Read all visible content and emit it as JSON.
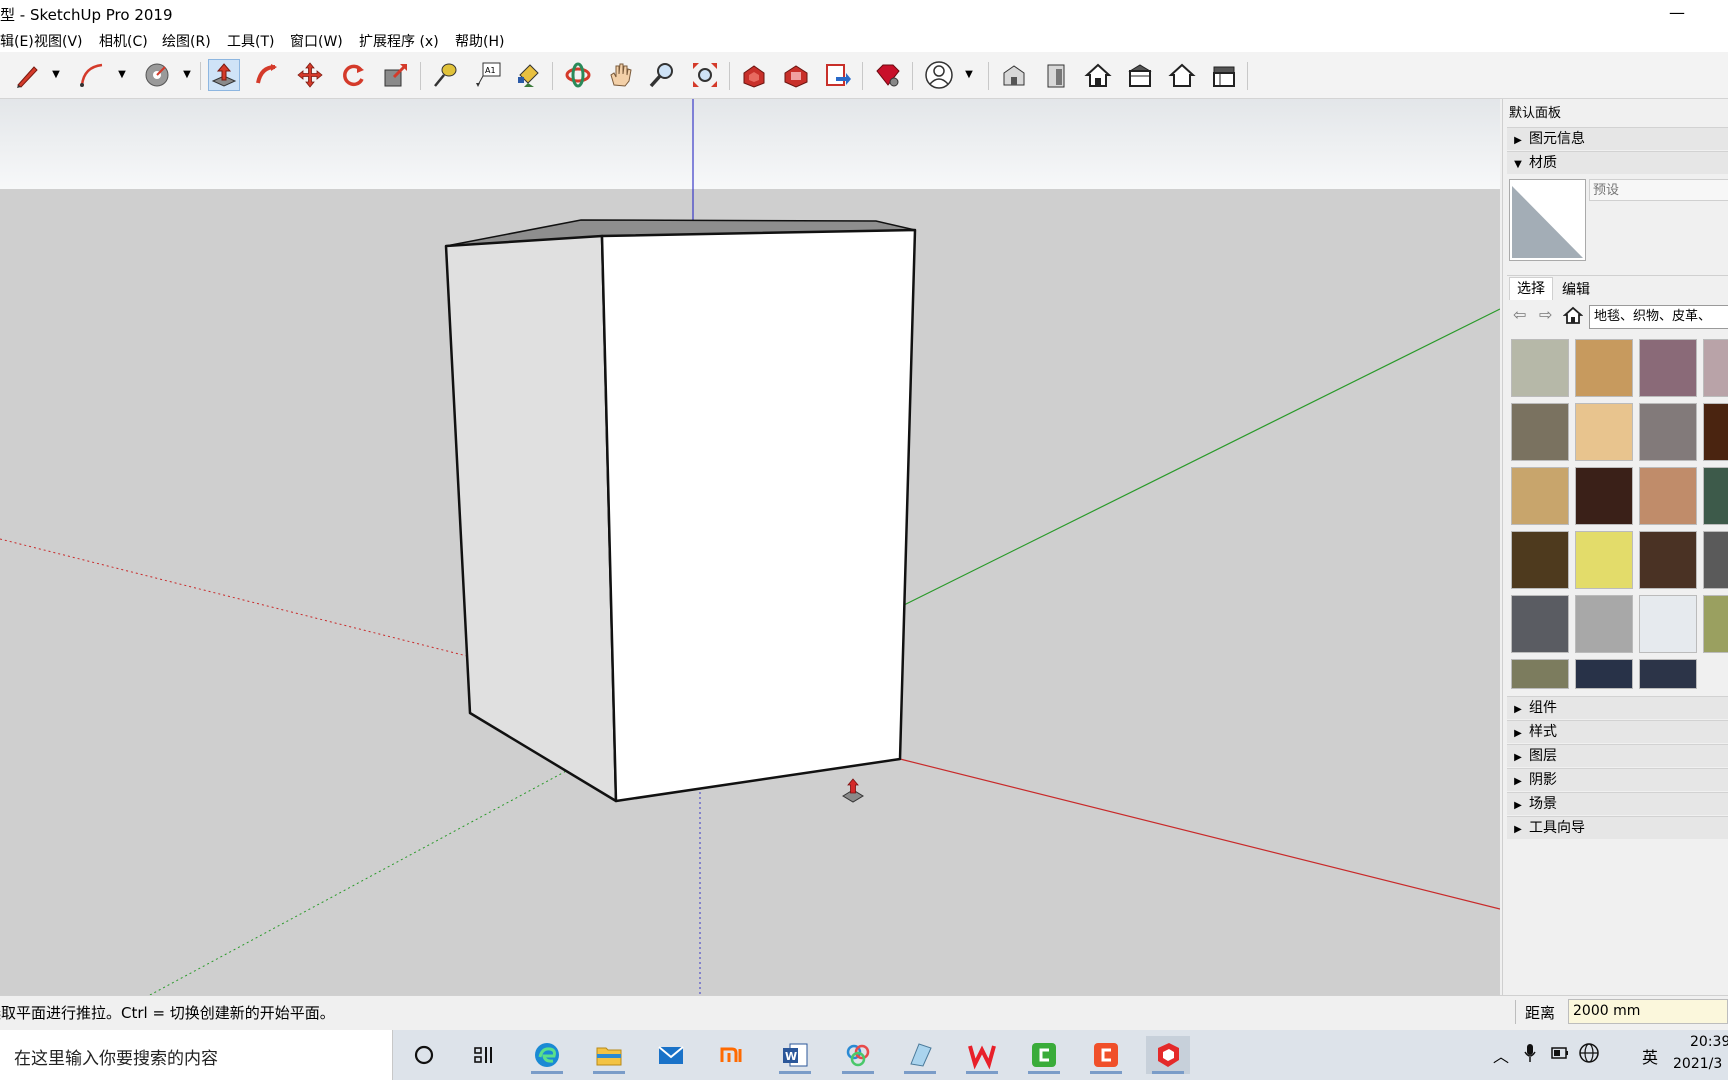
{
  "window": {
    "title": "型 - SketchUp Pro 2019",
    "minimize_glyph": "—"
  },
  "menu": [
    "编辑(E)",
    "视图(V)",
    "相机(C)",
    "绘图(R)",
    "工具(T)",
    "窗口(W)",
    "扩展程序 (x)",
    "帮助(H)"
  ],
  "toolbar": {
    "icons": [
      "pencil-icon",
      "arc-icon",
      "paint-bucket-icon",
      "push-pull-icon",
      "follow-me-icon",
      "move-icon",
      "rotate-icon",
      "scale-icon",
      "tape-measure-icon",
      "text-label-icon",
      "paint-icon",
      "orbit-icon",
      "pan-icon",
      "zoom-icon",
      "zoom-extents-icon",
      "warehouse-icon",
      "extension-warehouse-icon",
      "send-to-layout-icon",
      "ruby-extension-icon",
      "account-icon",
      "iso-view-icon",
      "front-view-icon",
      "home-view-icon",
      "top-view-icon",
      "back-view-icon",
      "side-view-icon"
    ],
    "active": "push-pull-icon",
    "text_tool_label": "A1"
  },
  "panel": {
    "title": "默认面板",
    "sections_top": [
      {
        "label": "图元信息",
        "expanded": false
      },
      {
        "label": "材质",
        "expanded": true
      }
    ],
    "material_name_placeholder": "预设",
    "tabs": [
      "选择",
      "编辑"
    ],
    "active_tab": "选择",
    "library_select_value": "地毯、织物、皮革、",
    "swatch_colors": [
      "#b6b8a8",
      "#c79a5e",
      "#8a6a78",
      "#b9a3a8",
      "#7a7260",
      "#e8c48e",
      "#827a7a",
      "#4a2410",
      "#c8a56c",
      "#3a2018",
      "#c08c6a",
      "#3d5a4a",
      "#4e3a1e",
      "#e3dc6a",
      "#4a3224",
      "#5a5a5a",
      "#5a5c62",
      "#a8a8a8",
      "#e6eaee",
      "#9aa060",
      "#7c7c5e",
      "#283248",
      "#2c3448"
    ],
    "sections_bottom": [
      {
        "label": "组件"
      },
      {
        "label": "样式"
      },
      {
        "label": "图层"
      },
      {
        "label": "阴影"
      },
      {
        "label": "场景"
      },
      {
        "label": "工具向导"
      }
    ]
  },
  "status": {
    "hint": "选取平面进行推拉。Ctrl = 切换创建新的开始平面。",
    "measure_label": "距离",
    "measure_value": "2000 mm"
  },
  "taskbar": {
    "search_placeholder": "在这里输入你要搜索的内容",
    "apps": [
      "cortana-icon",
      "task-view-icon",
      "edge-icon",
      "file-explorer-icon",
      "mail-icon",
      "mi-icon",
      "word-icon",
      "photos-icon",
      "notepad-icon",
      "wps-icon",
      "camtasia-green-icon",
      "camtasia-orange-icon",
      "sketchup-icon"
    ],
    "ime": "英",
    "time": "20:39",
    "date": "2021/3"
  }
}
